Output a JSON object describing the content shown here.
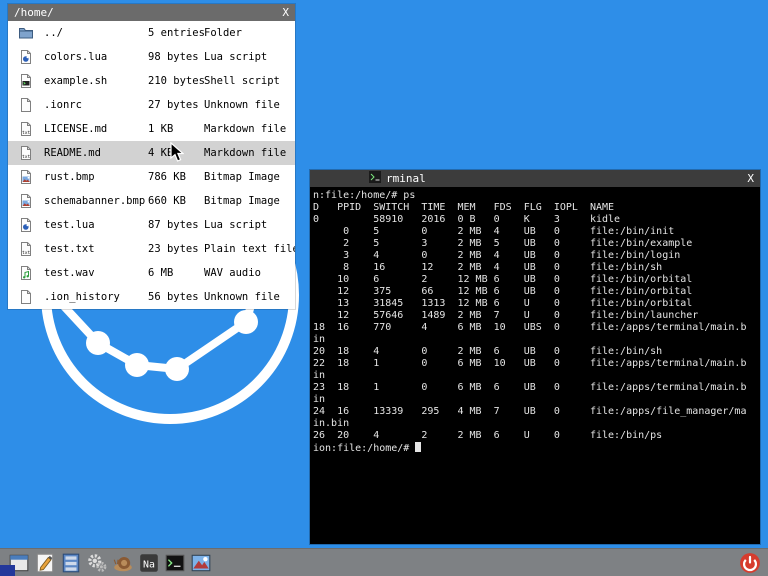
{
  "colors": {
    "desktop_background": "#2e8ee8",
    "file_manager_titlebar": "#6b6b6b",
    "terminal_titlebar": "#3c3c3c",
    "terminal_background": "#000000",
    "terminal_text": "#e4e4e4",
    "selection_highlight": "#d2d2d2",
    "taskbar": "#7e8184",
    "power_red": "#d63c2e",
    "corner_square": "#23389b",
    "logo_white": "#ffffff"
  },
  "file_manager": {
    "title": "/home/",
    "close_label": "X",
    "rows": [
      {
        "icon": "folder-icon",
        "name": "../",
        "size": "5 entries",
        "type": "Folder",
        "selected": false
      },
      {
        "icon": "lua-file-icon",
        "name": "colors.lua",
        "size": "98 bytes",
        "type": "Lua script",
        "selected": false
      },
      {
        "icon": "shell-file-icon",
        "name": "example.sh",
        "size": "210 bytes",
        "type": "Shell script",
        "selected": false
      },
      {
        "icon": "unknown-file-icon",
        "name": ".ionrc",
        "size": "27 bytes",
        "type": "Unknown file",
        "selected": false
      },
      {
        "icon": "text-file-icon",
        "name": "LICENSE.md",
        "size": "1 KB",
        "type": "Markdown file",
        "selected": false
      },
      {
        "icon": "text-file-icon",
        "name": "README.md",
        "size": "4 KB",
        "type": "Markdown file",
        "selected": true
      },
      {
        "icon": "image-file-icon",
        "name": "rust.bmp",
        "size": "786 KB",
        "type": "Bitmap Image",
        "selected": false
      },
      {
        "icon": "image-file-icon",
        "name": "schemabanner.bmp",
        "size": "660 KB",
        "type": "Bitmap Image",
        "selected": false
      },
      {
        "icon": "lua-file-icon",
        "name": "test.lua",
        "size": "87 bytes",
        "type": "Lua script",
        "selected": false
      },
      {
        "icon": "text-file-icon",
        "name": "test.txt",
        "size": "23 bytes",
        "type": "Plain text file",
        "selected": false
      },
      {
        "icon": "audio-file-icon",
        "name": "test.wav",
        "size": "6 MB",
        "type": "WAV audio",
        "selected": false
      },
      {
        "icon": "unknown-file-icon",
        "name": ".ion_history",
        "size": "56 bytes",
        "type": "Unknown file",
        "selected": false
      }
    ]
  },
  "terminal": {
    "title": "rminal",
    "close_label": "X",
    "lines": [
      "n:file:/home/# ps",
      "D   PPID  SWITCH  TIME  MEM   FDS  FLG  IOPL  NAME",
      "0         58910   2016  0 B   0    K    3     kidle",
      "     0    5       0     2 MB  4    UB   0     file:/bin/init",
      "     2    5       3     2 MB  5    UB   0     file:/bin/example",
      "     3    4       0     2 MB  4    UB   0     file:/bin/login",
      "     8    16      12    2 MB  4    UB   0     file:/bin/sh",
      "    10    6       2     12 MB 6    UB   0     file:/bin/orbital",
      "    12    375     66    12 MB 6    UB   0     file:/bin/orbital",
      "    13    31845   1313  12 MB 6    U    0     file:/bin/orbital",
      "    12    57646   1489  2 MB  7    U    0     file:/bin/launcher",
      "18  16    770     4     6 MB  10   UBS  0     file:/apps/terminal/main.b",
      "in",
      "20  18    4       0     2 MB  6    UB   0     file:/bin/sh",
      "22  18    1       0     6 MB  10   UB   0     file:/apps/terminal/main.b",
      "in",
      "23  18    1       0     6 MB  6    UB   0     file:/apps/terminal/main.b",
      "in",
      "24  16    13339   295   4 MB  7    UB   0     file:/apps/file_manager/ma",
      "in.bin",
      "26  20    4       2     2 MB  6    U    0     file:/bin/ps",
      "ion:file:/home/# "
    ]
  },
  "taskbar": {
    "items": [
      {
        "name": "taskbar-file-browser",
        "icon": "window-icon"
      },
      {
        "name": "taskbar-editor",
        "icon": "pencil-icon"
      },
      {
        "name": "taskbar-file-manager",
        "icon": "file-cabinet-icon"
      },
      {
        "name": "taskbar-settings",
        "icon": "gears-icon"
      },
      {
        "name": "taskbar-browser",
        "icon": "snail-icon"
      },
      {
        "name": "taskbar-sodium",
        "icon": "sodium-na-icon"
      },
      {
        "name": "taskbar-terminal",
        "icon": "terminal-icon"
      },
      {
        "name": "taskbar-image-viewer",
        "icon": "image-viewer-icon"
      }
    ],
    "power": {
      "name": "power-button",
      "icon": "power-icon"
    }
  }
}
